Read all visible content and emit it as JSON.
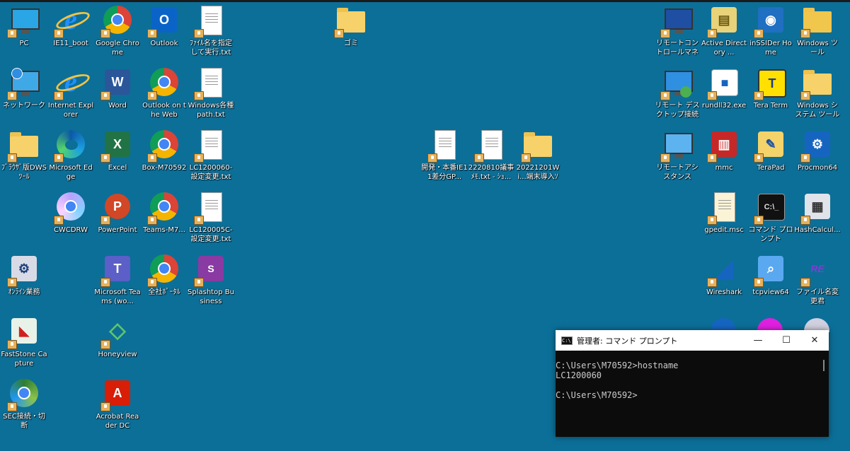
{
  "desktop": {
    "icons_left": [
      {
        "label": "PC",
        "kind": "monitor"
      },
      {
        "label": "IE11_boot",
        "kind": "ie"
      },
      {
        "label": "Google Chrome",
        "kind": "chrome"
      },
      {
        "label": "Outlook",
        "kind": "outlook"
      },
      {
        "label": "ﾌｧｲﾙ名を指定して実行.txt",
        "kind": "doc"
      },
      {
        "label": "ネットワーク",
        "kind": "network"
      },
      {
        "label": "Internet Explorer",
        "kind": "ie"
      },
      {
        "label": "Word",
        "kind": "word"
      },
      {
        "label": "Outlook on the Web",
        "kind": "chrome"
      },
      {
        "label": "Windows各種path.txt",
        "kind": "doc"
      },
      {
        "label": "ﾌﾞﾗｳｻﾞ版DWSﾂｰﾙ",
        "kind": "folder"
      },
      {
        "label": "Microsoft Edge",
        "kind": "edge"
      },
      {
        "label": "Excel",
        "kind": "excel"
      },
      {
        "label": "Box-M70592",
        "kind": "chrome"
      },
      {
        "label": "LC1200060-設定変更.txt",
        "kind": "doc"
      },
      {
        "label": "CWCDRW",
        "kind": "disc"
      },
      {
        "label": "PowerPoint",
        "kind": "ppt"
      },
      {
        "label": "Teams-M7...",
        "kind": "chrome"
      },
      {
        "label": "LC120005C-設定変更.txt",
        "kind": "doc"
      },
      {
        "label": "ｵﾝﾗｲﾝ業務",
        "kind": "tool"
      },
      {
        "label": "Microsoft Teams (wo...",
        "kind": "teams"
      },
      {
        "label": "全社ﾎﾟｰﾀﾙ",
        "kind": "chrome"
      },
      {
        "label": "Splashtop Business",
        "kind": "splashtop"
      },
      {
        "label": "FastStone Capture",
        "kind": "faststone"
      },
      {
        "label": "Honeyview",
        "kind": "honeyview"
      },
      {
        "label": "SEC接続・切断",
        "kind": "sec"
      },
      {
        "label": "Acrobat Reader DC",
        "kind": "acrobat"
      }
    ],
    "icons_middle": [
      {
        "label": "ゴミ",
        "kind": "folder"
      },
      {
        "label": "開発・本番IE11差分GP...",
        "kind": "doc"
      },
      {
        "label": "2220810議事ﾒﾓ.txt - ｼｮ...",
        "kind": "doc"
      },
      {
        "label": "20221201Wi...端末導入ｿﾌ...",
        "kind": "folder"
      }
    ],
    "icons_right": [
      {
        "label": "リモートコントロールマネージャ",
        "kind": "remote"
      },
      {
        "label": "Active Directory ...",
        "kind": "ad"
      },
      {
        "label": "inSSIDer Home",
        "kind": "inssider"
      },
      {
        "label": "Windows ツール",
        "kind": "wintools"
      },
      {
        "label": "リモート デスクトップ接続",
        "kind": "rdp"
      },
      {
        "label": "rundll32.exe",
        "kind": "rundll"
      },
      {
        "label": "Tera Term",
        "kind": "teraterm"
      },
      {
        "label": "Windows システム ツール",
        "kind": "folder"
      },
      {
        "label": "リモートアシスタンス",
        "kind": "rdp2"
      },
      {
        "label": "mmc",
        "kind": "mmc"
      },
      {
        "label": "TeraPad",
        "kind": "terapad"
      },
      {
        "label": "Procmon64",
        "kind": "procmon"
      },
      {
        "label": "gpedit.msc",
        "kind": "gpedit"
      },
      {
        "label": "コマンド プロンプト",
        "kind": "cmdicon"
      },
      {
        "label": "HashCalcul...",
        "kind": "calc"
      },
      {
        "label": "Wireshark",
        "kind": "wireshark"
      },
      {
        "label": "tcpview64",
        "kind": "tcpview"
      },
      {
        "label": "ファイル名変更君",
        "kind": "rename"
      }
    ]
  },
  "terminal": {
    "title": "管理者: コマンド プロンプト",
    "icon_text": "C:\\",
    "minimize": "—",
    "maximize": "☐",
    "close": "✕",
    "lines": [
      "C:\\Users\\M70592>hostname",
      "LC1200060",
      "",
      "C:\\Users\\M70592>"
    ]
  }
}
